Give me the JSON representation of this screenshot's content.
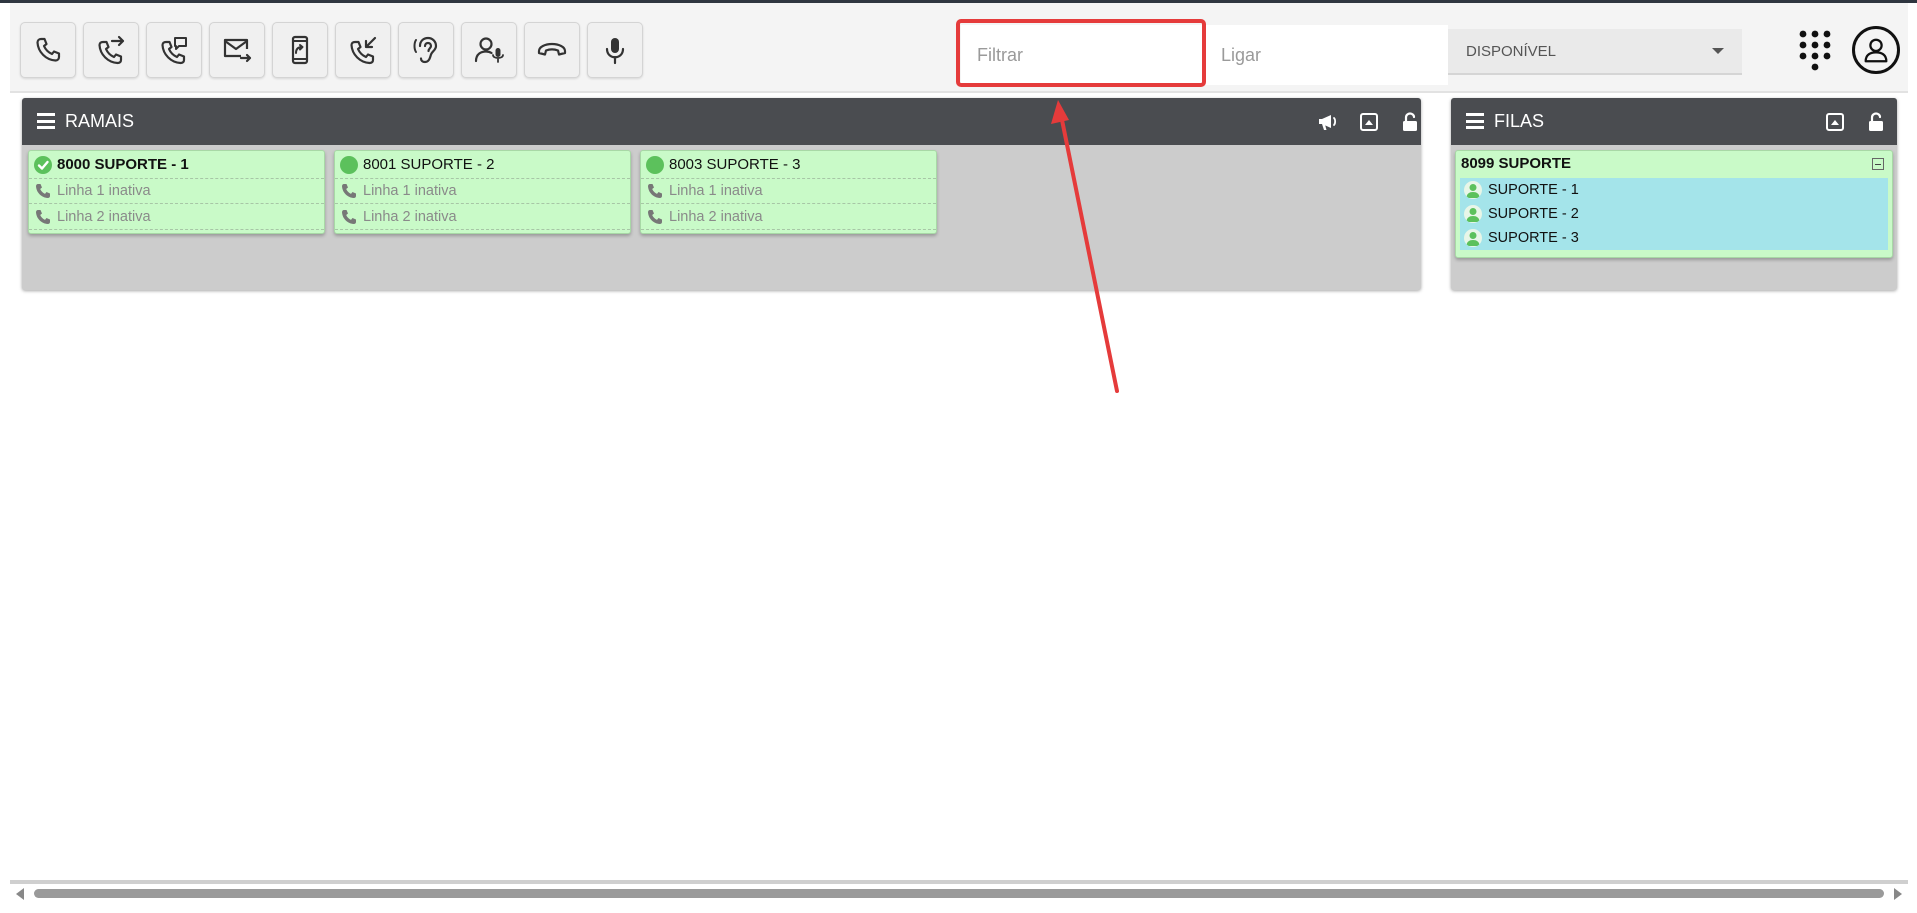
{
  "toolbar": {
    "buttons": [
      {
        "icon": "phone-icon"
      },
      {
        "icon": "phone-forward-icon"
      },
      {
        "icon": "phone-message-icon"
      },
      {
        "icon": "mail-forward-icon"
      },
      {
        "icon": "mobile-transfer-icon"
      },
      {
        "icon": "phone-incoming-icon"
      },
      {
        "icon": "ear-listen-icon"
      },
      {
        "icon": "user-voice-icon"
      },
      {
        "icon": "hangup-icon"
      },
      {
        "icon": "microphone-icon"
      }
    ],
    "filter_placeholder": "Filtrar",
    "call_placeholder": "Ligar",
    "status_value": "DISPONÍVEL",
    "dialpad_icon": "dialpad-icon",
    "user_icon": "user-account-icon"
  },
  "ramais": {
    "title": "RAMAIS",
    "header_icons": [
      "megaphone-icon",
      "panel-expand-icon",
      "unlock-icon"
    ],
    "extensions": [
      {
        "name": "8000 SUPORTE - 1",
        "status": "available-check",
        "lines": [
          "Linha 1 inativa",
          "Linha 2 inativa"
        ]
      },
      {
        "name": "8001 SUPORTE - 2",
        "status": "available",
        "lines": [
          "Linha 1 inativa",
          "Linha 2 inativa"
        ]
      },
      {
        "name": "8003 SUPORTE - 3",
        "status": "available",
        "lines": [
          "Linha 1 inativa",
          "Linha 2 inativa"
        ]
      }
    ]
  },
  "filas": {
    "title": "FILAS",
    "header_icons": [
      "panel-expand-icon",
      "unlock-icon"
    ],
    "queue": {
      "name": "8099 SUPORTE",
      "agents": [
        "SUPORTE - 1",
        "SUPORTE - 2",
        "SUPORTE - 3"
      ]
    }
  },
  "colors": {
    "header": "#4a4c50",
    "card_green": "#c9fac8",
    "agent_cyan": "#a4e4ea",
    "status_green": "#5cc15c",
    "annotation_red": "#e53b3b"
  }
}
